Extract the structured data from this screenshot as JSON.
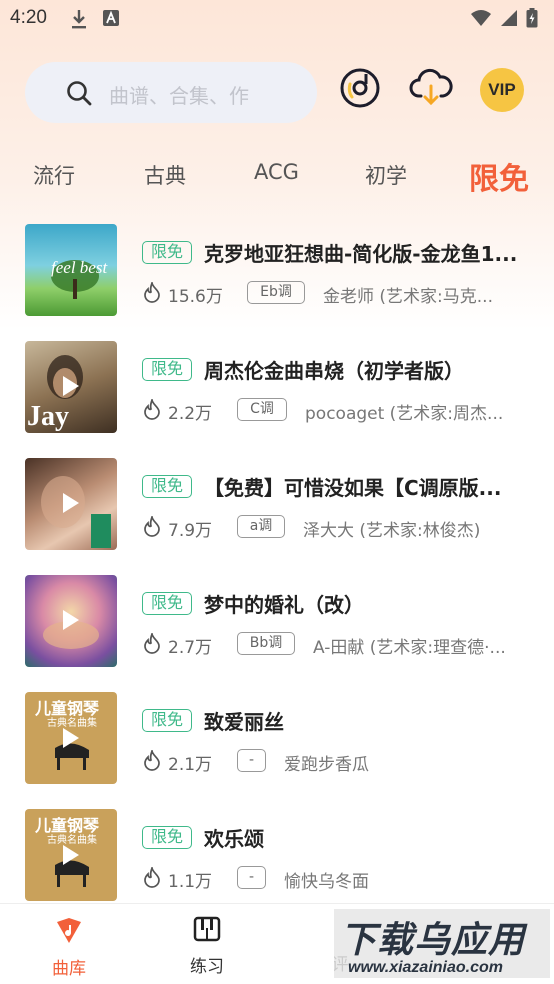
{
  "status_bar": {
    "time": "4:20"
  },
  "search": {
    "placeholder": "曲谱、合集、作"
  },
  "vip": {
    "label": "VIP"
  },
  "tabs": [
    {
      "label": "流行",
      "active": false
    },
    {
      "label": "古典",
      "active": false
    },
    {
      "label": "ACG",
      "active": false
    },
    {
      "label": "初学",
      "active": false
    },
    {
      "label": "限免",
      "active": true
    }
  ],
  "songs": [
    {
      "badge": "限免",
      "title": "克罗地亚狂想曲-简化版-金龙鱼1...",
      "plays": "15.6万",
      "key": "Eb调",
      "meta": "金老师   (艺术家:马克...",
      "cover_text": "feel best"
    },
    {
      "badge": "限免",
      "title": "周杰伦金曲串烧（初学者版）",
      "plays": "2.2万",
      "key": "C调",
      "meta": "pocoaget   (艺术家:周杰...",
      "cover_text": "Jay"
    },
    {
      "badge": "限免",
      "title": "【免费】可惜没如果【C调原版...",
      "plays": "7.9万",
      "key": "a调",
      "meta": "泽大大   (艺术家:林俊杰)",
      "cover_text": ""
    },
    {
      "badge": "限免",
      "title": "梦中的婚礼（改）",
      "plays": "2.7万",
      "key": "Bb调",
      "meta": "A-田献   (艺术家:理查德·...",
      "cover_text": ""
    },
    {
      "badge": "限免",
      "title": "致爱丽丝",
      "plays": "2.1万",
      "key": "-",
      "meta": "爱跑步香瓜",
      "cover_text": "儿童钢琴",
      "cover_sub": "古典名曲集"
    },
    {
      "badge": "限免",
      "title": "欢乐颂",
      "plays": "1.1万",
      "key": "-",
      "meta": "愉快乌冬面",
      "cover_text": "儿童钢琴",
      "cover_sub": "古典名曲集"
    }
  ],
  "bottom_nav": [
    {
      "label": "曲库",
      "active": true
    },
    {
      "label": "练习",
      "active": false
    },
    {
      "label": "评",
      "active": false
    }
  ],
  "watermark": {
    "main": "下载乌应用",
    "sub": "www.xiazainiao.com"
  },
  "colors": {
    "accent": "#f2603a",
    "badge_green": "#3fb98a",
    "vip_gold": "#f6c543"
  }
}
